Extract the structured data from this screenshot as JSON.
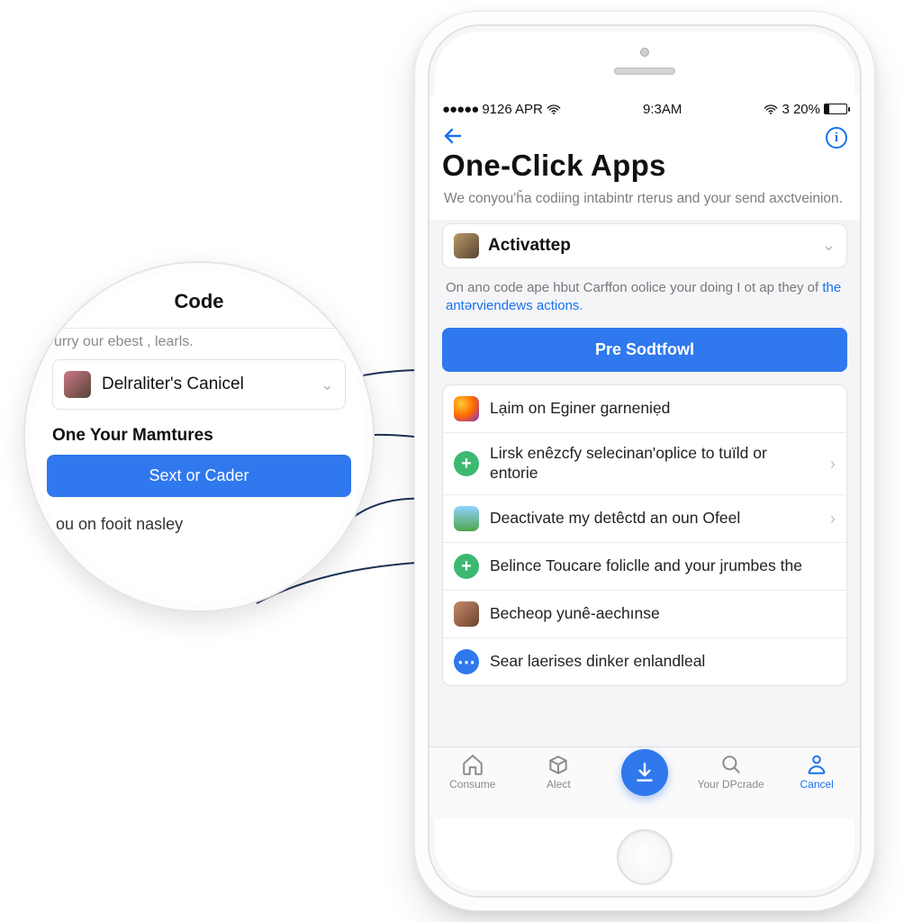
{
  "status": {
    "dots": "●●●●●",
    "carrier": "9126 APR",
    "time": "9:3AM",
    "battery_pct": "3 20%"
  },
  "header": {
    "title": "One-Click Apps",
    "subtitle": "We conyou'ȟa codiing intabintr rterus and your send axctveinion."
  },
  "selector": {
    "label": "Activattep"
  },
  "hint": {
    "prefix": "On ano code ape hbut Carffon oolice your doing I ot ap they of ",
    "link": "the antərviendews actions",
    "suffix": "."
  },
  "primary_button": "Pre Sodtfowl",
  "list": [
    {
      "icon": "firefox",
      "text": "Lạim on Eginer garneniẹd",
      "chevron": false
    },
    {
      "icon": "plus",
      "text": "Lirsk enêzcfy selecinan'oplice to tuïld or entorie",
      "chevron": true
    },
    {
      "icon": "sky",
      "text": "Deactivate my detêctd an oun Ofeel",
      "chevron": true
    },
    {
      "icon": "plus",
      "text": "Belince Toucare foliclle and your jrumbes the",
      "chevron": false
    },
    {
      "icon": "face",
      "text": "Becheop yunê‑aechınse",
      "chevron": false
    },
    {
      "icon": "blue",
      "text": "Sear laerises dinker enlandleal",
      "chevron": false
    }
  ],
  "tabs": [
    {
      "name": "consume",
      "label": "Consume"
    },
    {
      "name": "alect",
      "label": "Alect"
    },
    {
      "name": "fab",
      "label": ""
    },
    {
      "name": "search",
      "label": "Your DPcrade"
    },
    {
      "name": "cancel",
      "label": "Cancel"
    }
  ],
  "lens": {
    "title": "Code",
    "faint": "urry our ebest , learls.",
    "sel_label": "Delraliter's Canicel",
    "section": "One Your Mamtures",
    "button": "Sext or Cader",
    "footer": "ou on fooit nasley"
  }
}
